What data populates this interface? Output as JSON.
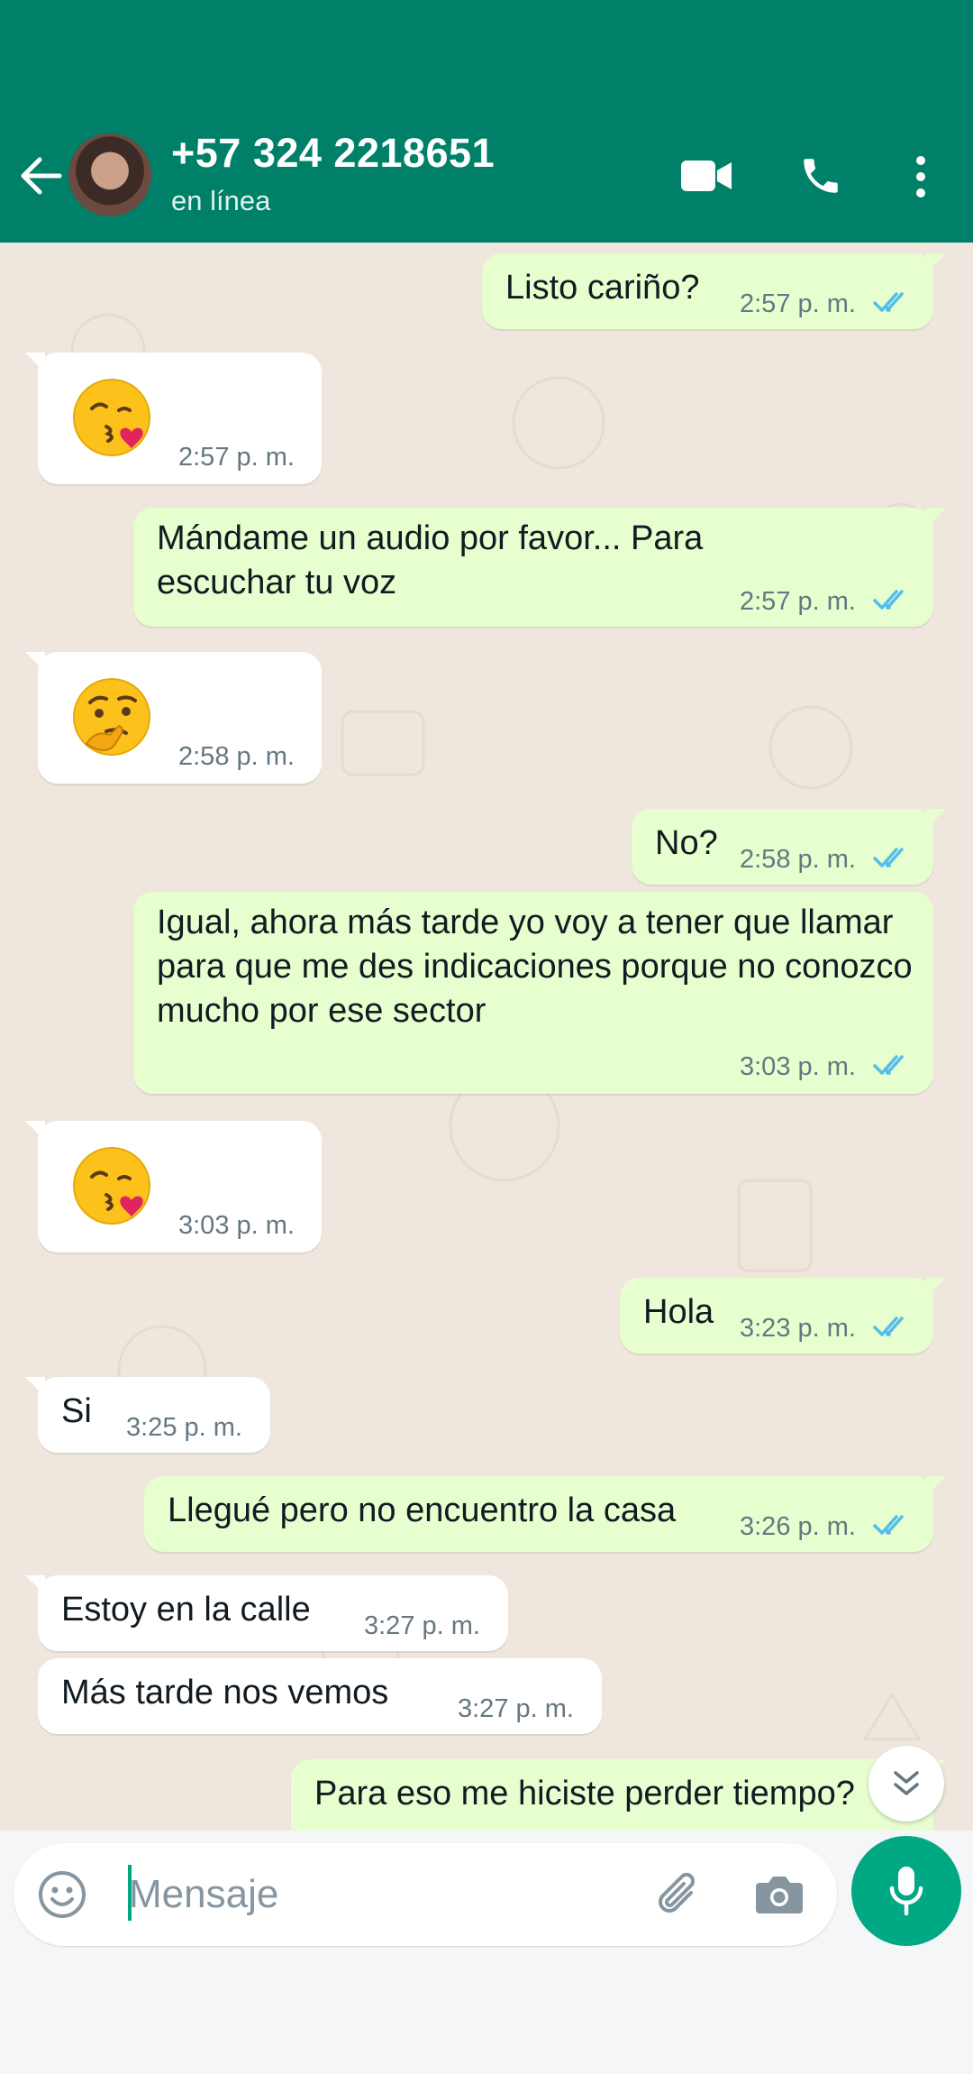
{
  "header": {
    "contact_name": "+57 324 2218651",
    "status": "en línea",
    "background_color": "#008069",
    "icons": [
      "back-arrow-icon",
      "video-call-icon",
      "voice-call-icon",
      "more-options-icon"
    ]
  },
  "messages": [
    {
      "direction": "out",
      "text": "Listo cariño?",
      "time": "2:57 p. m.",
      "read": true
    },
    {
      "direction": "in",
      "emoji": "face-blowing-a-kiss",
      "time": "2:57 p. m."
    },
    {
      "direction": "out",
      "text": "Mándame un audio por favor... Para escuchar tu voz",
      "time": "2:57 p. m.",
      "read": true
    },
    {
      "direction": "in",
      "emoji": "thinking-face",
      "time": "2:58 p. m."
    },
    {
      "direction": "out",
      "text": "No?",
      "time": "2:58 p. m.",
      "read": true
    },
    {
      "direction": "out",
      "text": "Igual, ahora más tarde yo voy a tener que llamar para que me des indicaciones porque no conozco mucho por ese sector",
      "time": "3:03 p. m.",
      "read": true
    },
    {
      "direction": "in",
      "emoji": "face-blowing-a-kiss",
      "time": "3:03 p. m."
    },
    {
      "direction": "out",
      "text": "Hola",
      "time": "3:23 p. m.",
      "read": true
    },
    {
      "direction": "in",
      "text": "Si",
      "time": "3:25 p. m."
    },
    {
      "direction": "out",
      "text": "Llegué pero no encuentro la casa",
      "time": "3:26 p. m.",
      "read": true
    },
    {
      "direction": "in",
      "text": "Estoy en la calle",
      "time": "3:27 p. m."
    },
    {
      "direction": "in",
      "text": "Más tarde nos vemos",
      "time": "3:27 p. m."
    },
    {
      "direction": "out",
      "text": "Para eso me hiciste perder tiempo?",
      "time": "",
      "read": false
    }
  ],
  "composer": {
    "placeholder": "Mensaje",
    "value": "",
    "icons": [
      "emoji-icon",
      "attach-icon",
      "camera-icon",
      "mic-icon"
    ]
  },
  "colors": {
    "chat_background": "#efe7dd",
    "outgoing_bubble": "#e7fecf",
    "incoming_bubble": "#ffffff",
    "read_ticks": "#53bdeb",
    "accent": "#00a884"
  }
}
